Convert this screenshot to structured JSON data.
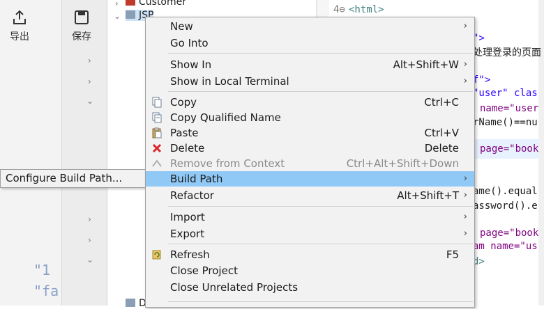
{
  "toolbar": {
    "export_label": "导出",
    "save_label": "保存"
  },
  "background": {
    "ghost_lines": [
      "\"1",
      "\"fa"
    ]
  },
  "explorer": {
    "items": [
      "Customer",
      "JSP",
      "D"
    ]
  },
  "editor": {
    "lines": [
      {
        "num": "4⊖",
        "text": "<html>"
      },
      {
        "text": "\">"
      },
      {
        "text": "处理登录的页面"
      },
      {
        "text": "f\">"
      },
      {
        "text": "\"user\" clas"
      },
      {
        "text": "name=\"user"
      },
      {
        "text": "rName()==nu"
      },
      {
        "text": "page=\"book"
      },
      {
        "text": "ame().equal"
      },
      {
        "text": "assword().e"
      },
      {
        "text": "page=\"book"
      },
      {
        "text": "am name=\"us"
      },
      {
        "text": "d>"
      }
    ]
  },
  "context_menu": {
    "items": [
      {
        "label": "New",
        "shortcut": "",
        "submenu": true
      },
      {
        "label": "Go Into",
        "shortcut": ""
      },
      {
        "label": "Show In",
        "shortcut": "Alt+Shift+W",
        "submenu": true
      },
      {
        "label": "Show in Local Terminal",
        "shortcut": "",
        "submenu": true
      },
      {
        "label": "Copy",
        "shortcut": "Ctrl+C",
        "icon": "copy-icon"
      },
      {
        "label": "Copy Qualified Name",
        "shortcut": "",
        "icon": "copy-qualified-icon"
      },
      {
        "label": "Paste",
        "shortcut": "Ctrl+V",
        "icon": "paste-icon"
      },
      {
        "label": "Delete",
        "shortcut": "Delete",
        "icon": "delete-icon"
      },
      {
        "label": "Remove from Context",
        "shortcut": "Ctrl+Alt+Shift+Down",
        "disabled": true,
        "icon": "remove-context-icon"
      },
      {
        "label": "Build Path",
        "shortcut": "",
        "submenu": true,
        "selected": true
      },
      {
        "label": "Refactor",
        "shortcut": "Alt+Shift+T",
        "submenu": true
      },
      {
        "label": "Import",
        "shortcut": "",
        "submenu": true
      },
      {
        "label": "Export",
        "shortcut": "",
        "submenu": true
      },
      {
        "label": "Refresh",
        "shortcut": "F5",
        "icon": "refresh-icon"
      },
      {
        "label": "Close Project",
        "shortcut": ""
      },
      {
        "label": "Close Unrelated Projects",
        "shortcut": ""
      }
    ]
  },
  "build_path_submenu": {
    "items": [
      {
        "label": "Configure Build Path..."
      }
    ]
  },
  "colors": {
    "selection": "#90c8f6",
    "menu_bg": "#f2f2f2",
    "delete_red": "#d9262a"
  }
}
